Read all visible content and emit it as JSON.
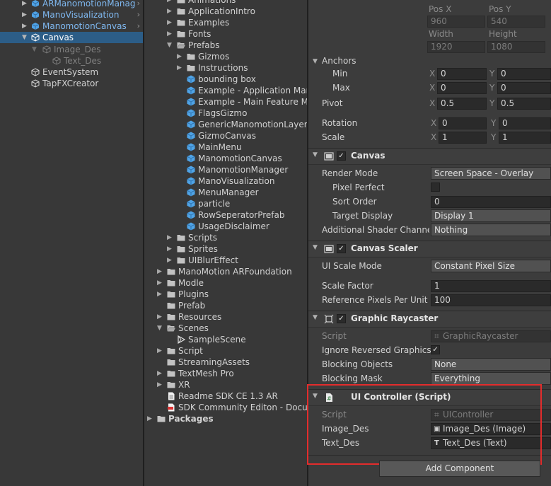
{
  "hierarchy": {
    "items": [
      {
        "label": "ARManomotionManag",
        "color": "#7fb8f0",
        "has_chevron": true
      },
      {
        "label": "ManoVisualization",
        "color": "#7fb8f0",
        "has_chevron": true
      },
      {
        "label": "ManomotionCanvas",
        "color": "#7fb8f0",
        "has_chevron": true
      },
      {
        "label": "Canvas",
        "color": "#ffffff",
        "selected": true
      },
      {
        "label": "Image_Des",
        "color": "#808080"
      },
      {
        "label": "Text_Des",
        "color": "#808080"
      },
      {
        "label": "EventSystem",
        "color": "#d2d2d2"
      },
      {
        "label": "TapFXCreator",
        "color": "#d2d2d2"
      }
    ]
  },
  "project": {
    "items": [
      {
        "label": "Animations",
        "type": "folder",
        "expanded": false
      },
      {
        "label": "ApplicationIntro",
        "type": "folder",
        "expanded": false
      },
      {
        "label": "Examples",
        "type": "folder",
        "expanded": false
      },
      {
        "label": "Fonts",
        "type": "folder",
        "expanded": false
      },
      {
        "label": "Prefabs",
        "type": "folder",
        "expanded": true
      },
      {
        "label": "Gizmos",
        "type": "folder",
        "expanded": false
      },
      {
        "label": "Instructions",
        "type": "folder",
        "expanded": false
      },
      {
        "label": "bounding box",
        "type": "prefab"
      },
      {
        "label": "Example - Application Mana",
        "type": "prefab"
      },
      {
        "label": "Example - Main Feature Me",
        "type": "prefab"
      },
      {
        "label": "FlagsGizmo",
        "type": "prefab"
      },
      {
        "label": "GenericManomotionLayer",
        "type": "prefab"
      },
      {
        "label": "GizmoCanvas",
        "type": "prefab"
      },
      {
        "label": "MainMenu",
        "type": "prefab"
      },
      {
        "label": "ManomotionCanvas",
        "type": "prefab"
      },
      {
        "label": "ManomotionManager",
        "type": "prefab"
      },
      {
        "label": "ManoVisualization",
        "type": "prefab"
      },
      {
        "label": "MenuManager",
        "type": "prefab"
      },
      {
        "label": "particle",
        "type": "prefab"
      },
      {
        "label": "RowSeperatorPrefab",
        "type": "prefab"
      },
      {
        "label": "UsageDisclaimer",
        "type": "prefab"
      },
      {
        "label": "Scripts",
        "type": "folder",
        "expanded": false
      },
      {
        "label": "Sprites",
        "type": "folder",
        "expanded": false
      },
      {
        "label": "UIBlurEffect",
        "type": "folder",
        "expanded": false
      },
      {
        "label": "ManoMotion ARFoundation",
        "type": "folder",
        "expanded": false
      },
      {
        "label": "Modle",
        "type": "folder",
        "expanded": false
      },
      {
        "label": "Plugins",
        "type": "folder",
        "expanded": false
      },
      {
        "label": "Prefab",
        "type": "folder",
        "leaf": true
      },
      {
        "label": "Resources",
        "type": "folder",
        "expanded": false
      },
      {
        "label": "Scenes",
        "type": "folder",
        "expanded": true
      },
      {
        "label": "SampleScene",
        "type": "scene"
      },
      {
        "label": "Script",
        "type": "folder",
        "expanded": false
      },
      {
        "label": "StreamingAssets",
        "type": "folder",
        "leaf": true
      },
      {
        "label": "TextMesh Pro",
        "type": "folder",
        "expanded": false
      },
      {
        "label": "XR",
        "type": "folder",
        "expanded": false
      },
      {
        "label": "Readme SDK CE 1.3 AR",
        "type": "text"
      },
      {
        "label": "SDK Community Editon - Docum",
        "type": "pdf"
      },
      {
        "label": "Packages",
        "type": "folder",
        "expanded": false,
        "bold": true
      }
    ]
  },
  "inspector": {
    "rect": {
      "pos_x_label": "Pos X",
      "pos_y_label": "Pos Y",
      "pos_x": "960",
      "pos_y": "540",
      "width_label": "Width",
      "height_label": "Height",
      "width": "1920",
      "height": "1080"
    },
    "anchors": {
      "label": "Anchors",
      "min_label": "Min",
      "max_label": "Max",
      "min_x": "0",
      "min_y": "0",
      "max_x": "0",
      "max_y": "0",
      "x": "X",
      "y": "Y"
    },
    "pivot": {
      "label": "Pivot",
      "x": "0.5",
      "y": "0.5"
    },
    "rotation": {
      "label": "Rotation",
      "x": "0",
      "y": "0"
    },
    "scale": {
      "label": "Scale",
      "x": "1",
      "y": "1"
    },
    "canvas": {
      "title": "Canvas",
      "render_mode_label": "Render Mode",
      "render_mode": "Screen Space - Overlay",
      "pixel_perfect_label": "Pixel Perfect",
      "sort_order_label": "Sort Order",
      "sort_order": "0",
      "target_display_label": "Target Display",
      "target_display": "Display 1",
      "shader_channels_label": "Additional Shader Channels",
      "shader_channels": "Nothing"
    },
    "canvas_scaler": {
      "title": "Canvas Scaler",
      "ui_scale_mode_label": "UI Scale Mode",
      "ui_scale_mode": "Constant Pixel Size",
      "scale_factor_label": "Scale Factor",
      "scale_factor": "1",
      "ref_ppu_label": "Reference Pixels Per Unit",
      "ref_ppu": "100"
    },
    "graphic_raycaster": {
      "title": "Graphic Raycaster",
      "script_label": "Script",
      "script": "GraphicRaycaster",
      "ignore_reversed_label": "Ignore Reversed Graphics",
      "blocking_objects_label": "Blocking Objects",
      "blocking_objects": "None",
      "blocking_mask_label": "Blocking Mask",
      "blocking_mask": "Everything"
    },
    "ui_controller": {
      "title": "UI Controller (Script)",
      "script_label": "Script",
      "script": "UIController",
      "image_des_label": "Image_Des",
      "image_des": "Image_Des (Image)",
      "text_des_label": "Text_Des",
      "text_des": "Text_Des (Text)"
    },
    "add_component": "Add Component"
  },
  "colors": {
    "selection": "#2c5d87",
    "highlight_box": "#e32c2c",
    "prefab_blue": "#4fa3e6"
  }
}
